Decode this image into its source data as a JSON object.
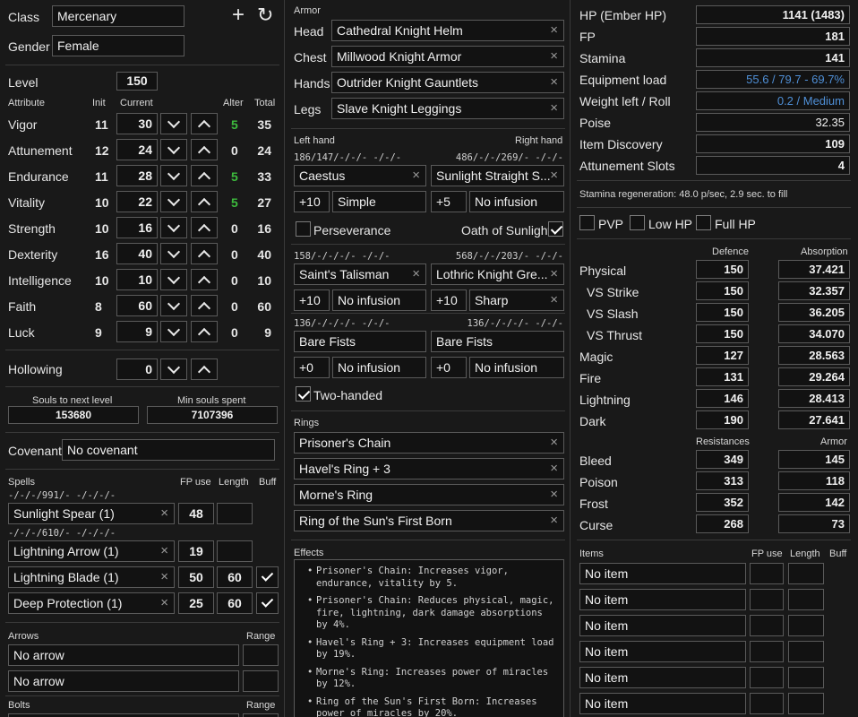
{
  "char": {
    "class_label": "Class",
    "class_value": "Mercenary",
    "gender_label": "Gender",
    "gender_value": "Female",
    "level_label": "Level",
    "level_value": "150"
  },
  "attr_headers": {
    "attribute": "Attribute",
    "init": "Init",
    "current": "Current",
    "alter": "Alter",
    "total": "Total"
  },
  "attributes": [
    {
      "name": "Vigor",
      "init": "11",
      "current": "30",
      "alter": "5",
      "total": "35",
      "alter_green": true
    },
    {
      "name": "Attunement",
      "init": "12",
      "current": "24",
      "alter": "0",
      "total": "24"
    },
    {
      "name": "Endurance",
      "init": "11",
      "current": "28",
      "alter": "5",
      "total": "33",
      "alter_green": true
    },
    {
      "name": "Vitality",
      "init": "10",
      "current": "22",
      "alter": "5",
      "total": "27",
      "alter_green": true
    },
    {
      "name": "Strength",
      "init": "10",
      "current": "16",
      "alter": "0",
      "total": "16"
    },
    {
      "name": "Dexterity",
      "init": "16",
      "current": "40",
      "alter": "0",
      "total": "40"
    },
    {
      "name": "Intelligence",
      "init": "10",
      "current": "10",
      "alter": "0",
      "total": "10"
    },
    {
      "name": "Faith",
      "init": "8",
      "current": "60",
      "alter": "0",
      "total": "60"
    },
    {
      "name": "Luck",
      "init": "9",
      "current": "9",
      "alter": "0",
      "total": "9"
    }
  ],
  "hollowing": {
    "label": "Hollowing",
    "value": "0"
  },
  "souls": {
    "next_label": "Souls to next level",
    "next_value": "153680",
    "min_label": "Min souls spent",
    "min_value": "7107396"
  },
  "covenant": {
    "label": "Covenant",
    "value": "No covenant"
  },
  "spells": {
    "label": "Spells",
    "fp_label": "FP use",
    "length_label": "Length",
    "buff_label": "Buff",
    "items": [
      {
        "stats": "-/-/-/991/-  -/-/-/-",
        "name": "Sunlight Spear (1)",
        "fp": "48",
        "length": "",
        "buff": false,
        "buff_shown": false
      },
      {
        "stats": "-/-/-/610/-  -/-/-/-",
        "name": "Lightning Arrow (1)",
        "fp": "19",
        "length": "",
        "buff": false,
        "buff_shown": false
      },
      {
        "stats": "",
        "name": "Lightning Blade (1)",
        "fp": "50",
        "length": "60",
        "buff": true,
        "buff_shown": true
      },
      {
        "stats": "",
        "name": "Deep Protection (1)",
        "fp": "25",
        "length": "60",
        "buff": true,
        "buff_shown": true
      }
    ]
  },
  "arrows": {
    "label": "Arrows",
    "range_label": "Range",
    "items": [
      "No arrow",
      "No arrow"
    ]
  },
  "bolts": {
    "label": "Bolts",
    "range_label": "Range"
  },
  "armor": {
    "label": "Armor",
    "slots": [
      {
        "slot": "Head",
        "item": "Cathedral Knight Helm"
      },
      {
        "slot": "Chest",
        "item": "Millwood Knight Armor"
      },
      {
        "slot": "Hands",
        "item": "Outrider Knight Gauntlets"
      },
      {
        "slot": "Legs",
        "item": "Slave Knight Leggings"
      }
    ]
  },
  "hands": {
    "left_label": "Left hand",
    "right_label": "Right hand",
    "rows": [
      {
        "left_stats": "186/147/-/-/-  -/-/-",
        "right_stats": "486/-/-/269/-  -/-/-",
        "left_weapon": "Caestus",
        "right_weapon": "Sunlight Straight S...",
        "left_plus": "+10",
        "left_infusion": "Simple",
        "right_plus": "+5",
        "right_infusion": "No infusion",
        "left_x": true,
        "right_x": true,
        "left_inf_x": false,
        "right_inf_x": false
      },
      {
        "left_stats": "158/-/-/-/-  -/-/-",
        "right_stats": "568/-/-/203/-  -/-/-",
        "left_weapon": "Saint's Talisman",
        "right_weapon": "Lothric Knight Gre...",
        "left_plus": "+10",
        "left_infusion": "No infusion",
        "right_plus": "+10",
        "right_infusion": "Sharp",
        "left_x": true,
        "right_x": true,
        "left_inf_x": false,
        "right_inf_x": true
      },
      {
        "left_stats": "136/-/-/-/-  -/-/-",
        "right_stats": "136/-/-/-/-  -/-/-",
        "left_weapon": "Bare Fists",
        "right_weapon": "Bare Fists",
        "left_plus": "+0",
        "left_infusion": "No infusion",
        "right_plus": "+0",
        "right_infusion": "No infusion",
        "left_x": false,
        "right_x": false,
        "left_inf_x": false,
        "right_inf_x": false
      }
    ],
    "perseverance": "Perseverance",
    "oath": "Oath of Sunlight",
    "two_handed": "Two-handed"
  },
  "rings": {
    "label": "Rings",
    "items": [
      "Prisoner's Chain",
      "Havel's Ring + 3",
      "Morne's Ring",
      "Ring of the Sun's First Born"
    ]
  },
  "effects": {
    "label": "Effects",
    "items": [
      "Prisoner's Chain: Increases vigor, endurance, vitality by 5.",
      "Prisoner's Chain: Reduces physical, magic, fire, lightning, dark damage absorptions by 4%.",
      "Havel's Ring + 3: Increases equipment load by 19%.",
      "Morne's Ring: Increases power of miracles by 12%.",
      "Ring of the Sun's First Born: Increases power of miracles by 20%."
    ]
  },
  "stats": [
    {
      "label": "HP (Ember HP)",
      "value": "1141 (1483)",
      "bold": true
    },
    {
      "label": "FP",
      "value": "181",
      "bold": true
    },
    {
      "label": "Stamina",
      "value": "141",
      "bold": true
    },
    {
      "label": "Equipment load",
      "value": "55.6 / 79.7 - 69.7%",
      "blue": true
    },
    {
      "label": "Weight left / Roll",
      "value": "0.2 / Medium",
      "blue": true
    },
    {
      "label": "Poise",
      "value": "32.35"
    },
    {
      "label": "Item Discovery",
      "value": "109",
      "bold": true
    },
    {
      "label": "Attunement Slots",
      "value": "4",
      "bold": true
    }
  ],
  "stamina_regen": "Stamina regeneration: 48.0 p/sec, 2.9 sec. to fill",
  "toggles": [
    "PVP",
    "Low HP",
    "Full HP"
  ],
  "defence": {
    "defence_label": "Defence",
    "absorption_label": "Absorption",
    "rows": [
      {
        "name": "Physical",
        "def": "150",
        "abs": "37.421"
      },
      {
        "name": "VS Strike",
        "def": "150",
        "abs": "32.357"
      },
      {
        "name": "VS Slash",
        "def": "150",
        "abs": "36.205"
      },
      {
        "name": "VS Thrust",
        "def": "150",
        "abs": "34.070"
      },
      {
        "name": "Magic",
        "def": "127",
        "abs": "28.563"
      },
      {
        "name": "Fire",
        "def": "131",
        "abs": "29.264"
      },
      {
        "name": "Lightning",
        "def": "146",
        "abs": "28.413"
      },
      {
        "name": "Dark",
        "def": "190",
        "abs": "27.641"
      }
    ]
  },
  "resist": {
    "resistances_label": "Resistances",
    "armor_label": "Armor",
    "rows": [
      {
        "name": "Bleed",
        "res": "349",
        "arm": "145"
      },
      {
        "name": "Poison",
        "res": "313",
        "arm": "118"
      },
      {
        "name": "Frost",
        "res": "352",
        "arm": "142"
      },
      {
        "name": "Curse",
        "res": "268",
        "arm": "73"
      }
    ]
  },
  "items": {
    "label": "Items",
    "fp_label": "FP use",
    "length_label": "Length",
    "buff_label": "Buff",
    "rows": [
      "No item",
      "No item",
      "No item",
      "No item",
      "No item",
      "No item"
    ]
  },
  "colors": {
    "background": "#191919",
    "field": "#121212",
    "border": "#5a5a5a",
    "blue_value": "#4f8fd6",
    "green_value": "#3dbb3d"
  }
}
